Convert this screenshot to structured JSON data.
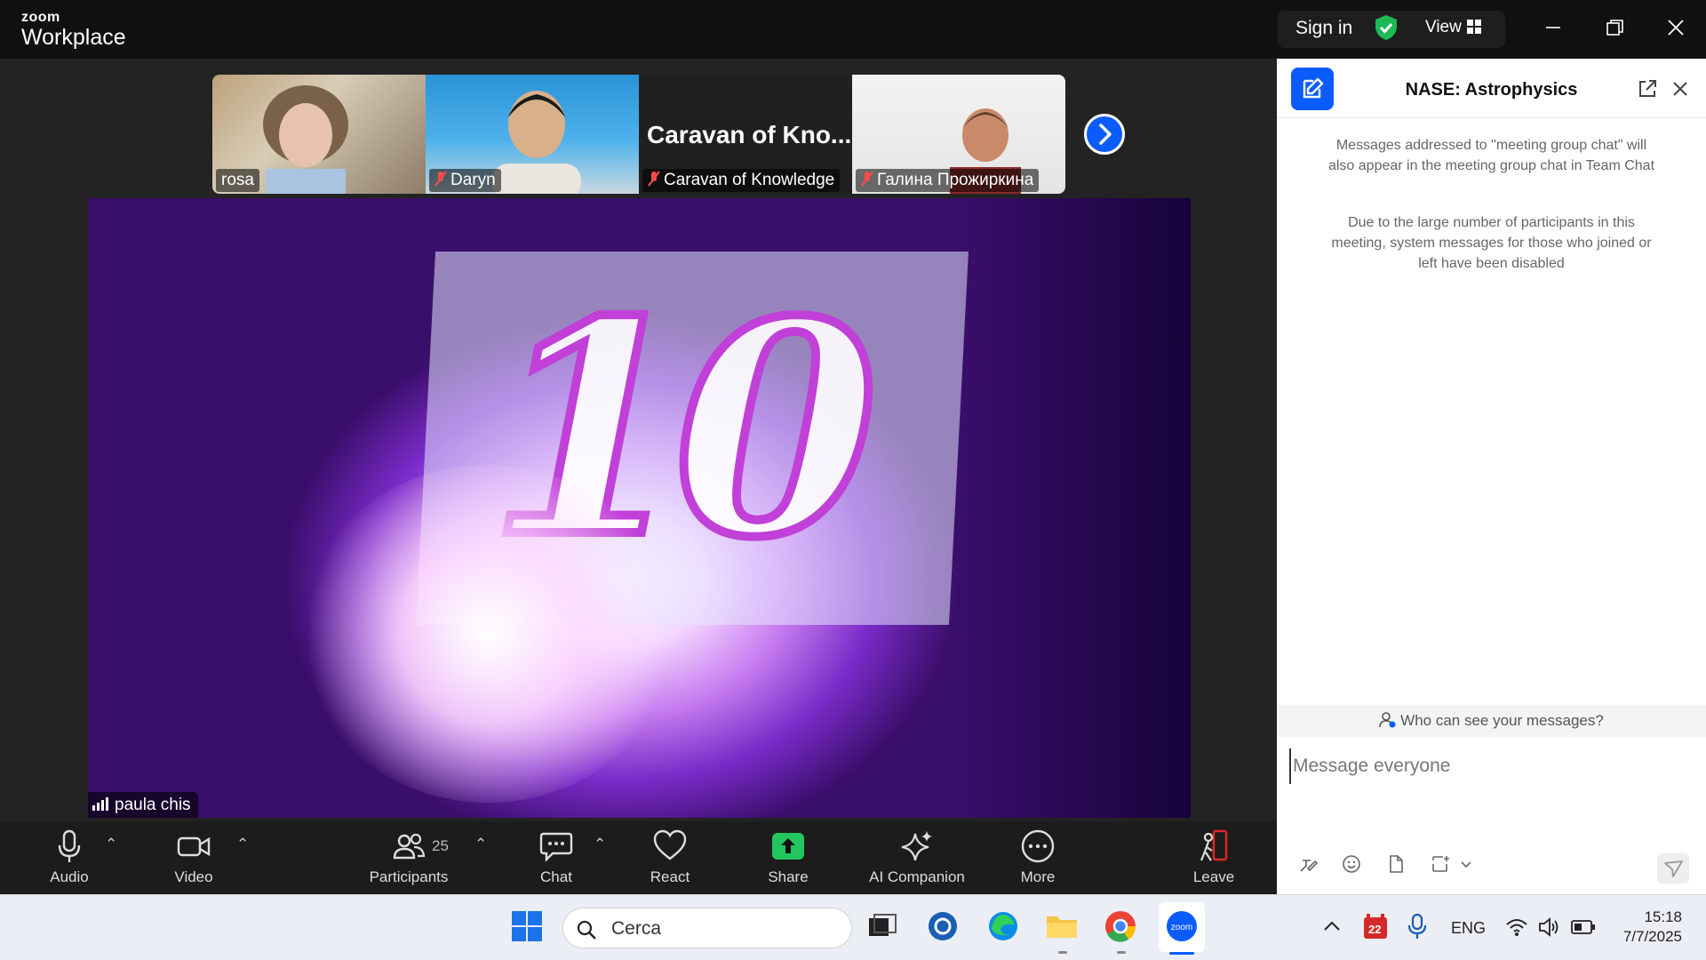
{
  "titlebar": {
    "logo_top": "zoom",
    "logo_bottom": "Workplace",
    "sign_in": "Sign in",
    "view_label": "View"
  },
  "thumbnails": [
    {
      "name": "rosa",
      "muted": false
    },
    {
      "name": "Daryn",
      "muted": true
    },
    {
      "name": "Caravan of Knowledge",
      "muted": true,
      "display_text": "Caravan of Kno..."
    },
    {
      "name": "Галина Прожиркина",
      "muted": true
    }
  ],
  "main_video": {
    "speaker_name": "paula chis",
    "number_shown": "10"
  },
  "toolbar": {
    "audio": "Audio",
    "video": "Video",
    "participants": "Participants",
    "participant_count": "25",
    "chat": "Chat",
    "react": "React",
    "share": "Share",
    "ai_companion": "AI Companion",
    "more": "More",
    "leave": "Leave"
  },
  "chat_panel": {
    "title": "NASE: Astrophysics",
    "system_message_1": "Messages addressed to \"meeting group chat\" will also appear in the meeting group chat in Team Chat",
    "system_message_2": "Due to the large number of participants in this meeting, system messages for those who joined or left have been disabled",
    "who_can_see": "Who can see your messages?",
    "input_placeholder": "Message everyone"
  },
  "taskbar": {
    "search_placeholder": "Cerca",
    "calendar_badge": "22",
    "language": "ENG",
    "time": "15:18",
    "date": "7/7/2025"
  },
  "colors": {
    "accent": "#0b5cff",
    "share_green": "#22c55e",
    "leave_red": "#e02828",
    "titlebar_bg": "#111111",
    "meeting_bg": "#232323"
  }
}
